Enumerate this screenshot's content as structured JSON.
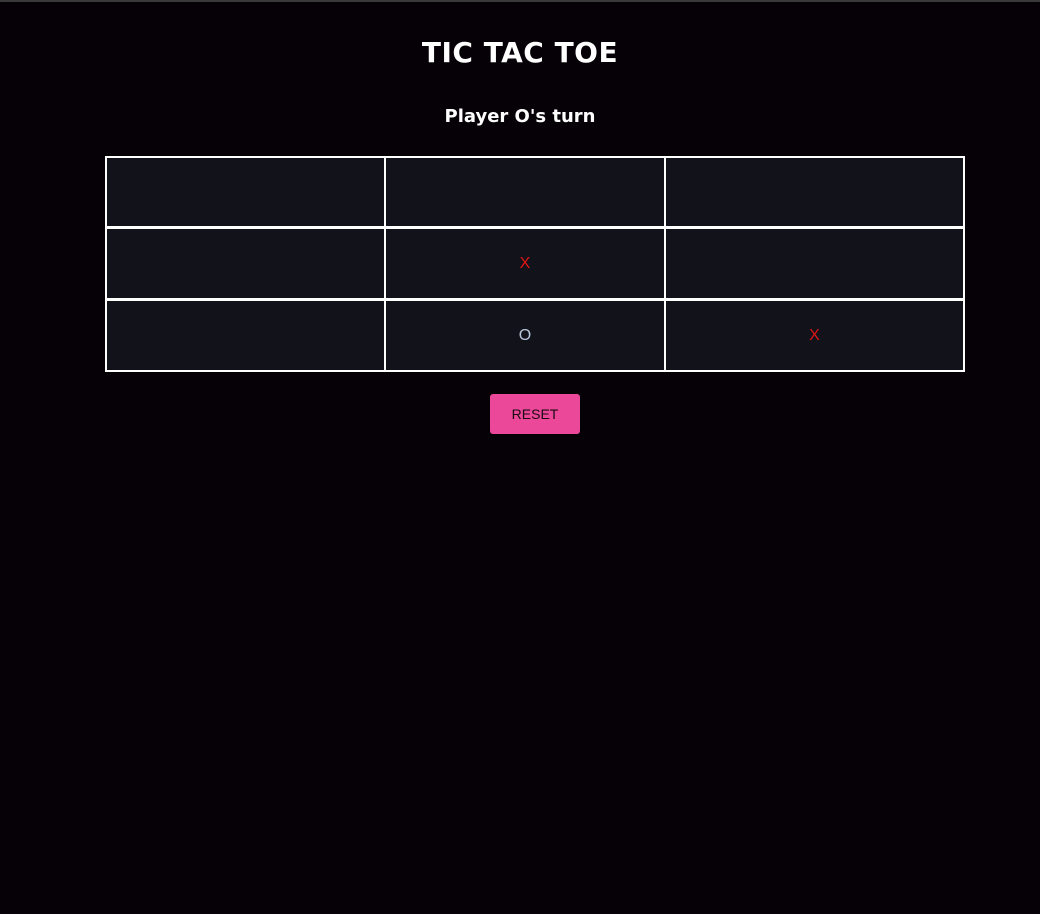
{
  "game": {
    "title": "TIC TAC TOE",
    "status": "Player O's turn",
    "board": [
      [
        "",
        "",
        ""
      ],
      [
        "",
        "X",
        ""
      ],
      [
        "",
        "O",
        "X"
      ]
    ]
  },
  "controls": {
    "reset_label": "RESET"
  },
  "colors": {
    "background": "#060106",
    "cell_background": "#12121a",
    "x_mark": "#e01515",
    "o_mark": "#b8c4d8",
    "reset_button": "#ec4899"
  }
}
